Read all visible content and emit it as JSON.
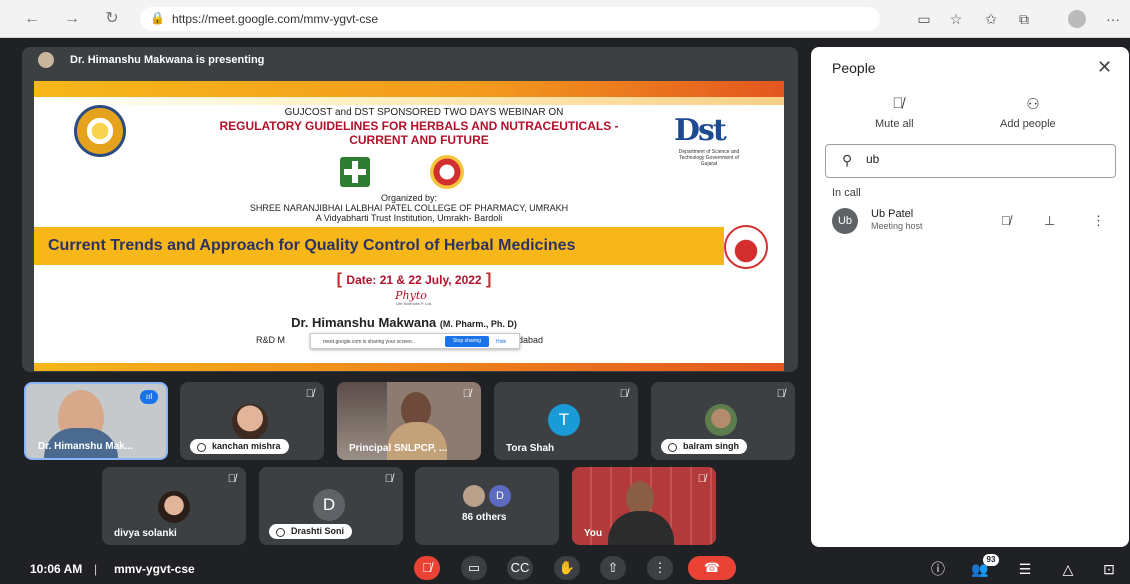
{
  "browser": {
    "url": "https://meet.google.com/mmv-ygvt-cse",
    "nav": {
      "back": "←",
      "forward": "→",
      "reload": "↻"
    },
    "icons": [
      "camera-icon",
      "read-aloud-icon",
      "favorites-icon",
      "collections-icon",
      "profile-icon",
      "more-icon"
    ]
  },
  "stage": {
    "presenter_text": "Dr. Himanshu Makwana is presenting"
  },
  "slide": {
    "line1": "GUJCOST and DST SPONSORED TWO DAYS WEBINAR ON",
    "line2": "REGULATORY GUIDELINES FOR HERBALS AND NUTRACEUTICALS -",
    "line3": "CURRENT AND FUTURE",
    "dst_logo": "Dst",
    "dst_sub": "Department of Science and Technology Government of Gujarat",
    "organized_by": "Organized by:",
    "college": "SHREE NARANJIBHAI LALBHAI PATEL COLLEGE OF PHARMACY, UMRAKH",
    "trust": "A Vidyabharti Trust Institution, Umrakh- Bardoli",
    "topic": "Current Trends and Approach for Quality Control of Herbal Medicines",
    "date_label": "Date: 21 & 22 July, 2022",
    "sponsor": "Phyto",
    "sponsor_sub": "Life Sciences P. Ltd.",
    "speaker": "Dr. Himanshu Makwana",
    "speaker_degree": "(M. Pharm., Ph. D)",
    "rnd": "R&D M",
    "city_tail": "dabad"
  },
  "share_popup": {
    "message": "meet.google.com is sharing your screen.",
    "stop": "Stop sharing",
    "hide": "Hide"
  },
  "participants": [
    {
      "name": "Dr. Himanshu Mak..."
    },
    {
      "name": "kanchan mishra"
    },
    {
      "name": "Principal SNLPCP, ..."
    },
    {
      "name": "Tora Shah",
      "initial": "T"
    },
    {
      "name": "balram singh"
    },
    {
      "name": "divya solanki"
    },
    {
      "name": "Drashti Soni",
      "initial": "D"
    },
    {
      "name": "86 others",
      "initial": "D"
    },
    {
      "name": "You"
    }
  ],
  "bottom": {
    "time": "10:06 AM",
    "separator": "|",
    "meeting_code": "mmv-ygvt-cse",
    "participant_count": "93"
  },
  "panel": {
    "title": "People",
    "mute_all": "Mute all",
    "add_people": "Add people",
    "search_value": "ub",
    "in_call": "In call",
    "member": {
      "avatar": "Ub",
      "name": "Ub Patel",
      "role": "Meeting host"
    }
  },
  "colors": {
    "meet_dark": "#202124",
    "tile": "#3c4043",
    "end_call": "#ea4335",
    "accent": "#1a73e8"
  }
}
